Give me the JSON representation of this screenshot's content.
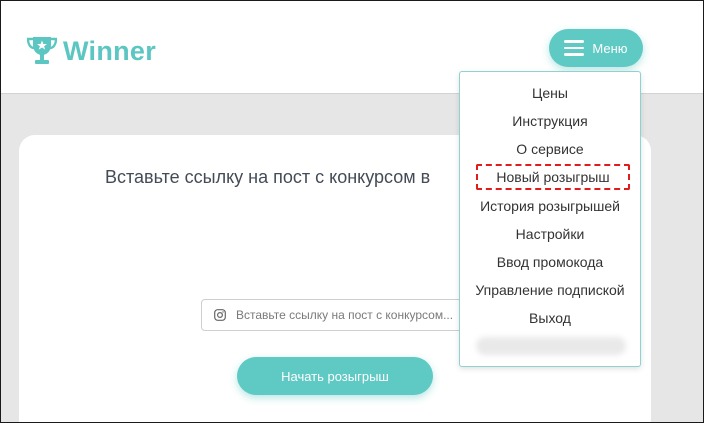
{
  "logo": {
    "text": "Winner",
    "icon": "trophy-icon"
  },
  "header": {
    "menu_label": "Меню",
    "menu_icon": "hamburger-icon"
  },
  "main": {
    "title": "Вставьте ссылку на пост с конкурсом в",
    "input_placeholder": "Вставьте ссылку на пост с конкурсом...",
    "input_icon": "instagram-icon",
    "start_button": "Начать розыгрыш"
  },
  "menu": {
    "items": [
      {
        "label": "Цены"
      },
      {
        "label": "Инструкция"
      },
      {
        "label": "О сервисе"
      },
      {
        "label": "Новый розыгрыш",
        "highlighted": true
      },
      {
        "label": "История розыгрышей"
      },
      {
        "label": "Настройки"
      },
      {
        "label": "Ввод промокода"
      },
      {
        "label": "Управление подпиской"
      },
      {
        "label": "Выход"
      }
    ]
  },
  "colors": {
    "accent": "#5fc9c4",
    "highlight_border": "#e01c1c",
    "text": "#333333"
  }
}
